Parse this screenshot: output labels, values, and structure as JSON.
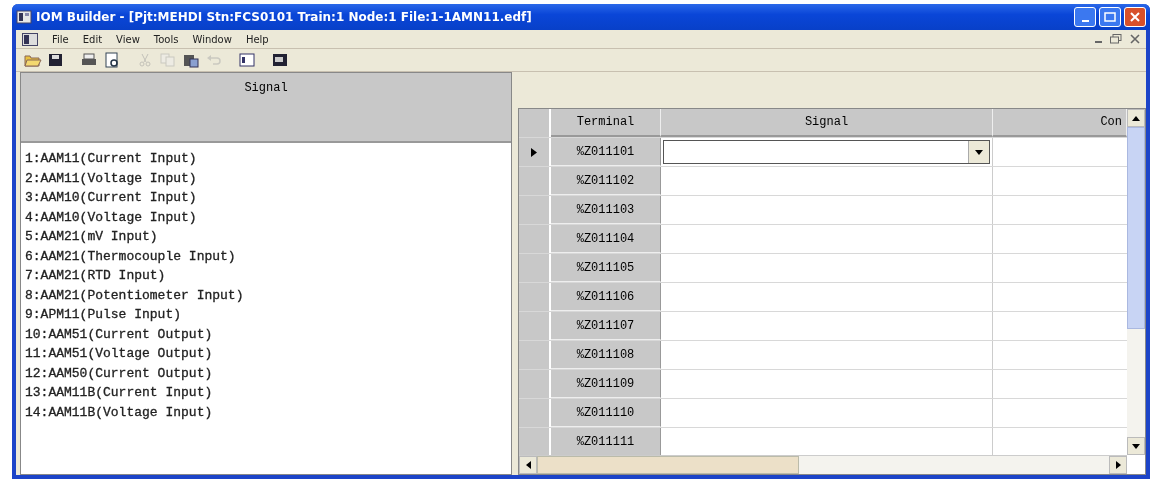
{
  "window": {
    "title": "IOM Builder - [Pjt:MEHDI Stn:FCS0101 Train:1 Node:1 File:1-1AMN11.edf]"
  },
  "menu": [
    "File",
    "Edit",
    "View",
    "Tools",
    "Window",
    "Help"
  ],
  "toolbar": [
    {
      "kind": "open",
      "disabled": false
    },
    {
      "kind": "save",
      "disabled": false
    },
    {
      "kind": "print",
      "disabled": false
    },
    {
      "kind": "preview",
      "disabled": false
    },
    {
      "kind": "cut",
      "disabled": true
    },
    {
      "kind": "copy",
      "disabled": true
    },
    {
      "kind": "paste",
      "disabled": false
    },
    {
      "kind": "undo",
      "disabled": true
    },
    {
      "kind": "panel-left",
      "disabled": false
    },
    {
      "kind": "panel-dark",
      "disabled": false
    }
  ],
  "signal_list": {
    "header": "Signal",
    "items": [
      "1:AAM11(Current Input)",
      "2:AAM11(Voltage Input)",
      "3:AAM10(Current Input)",
      "4:AAM10(Voltage Input)",
      "5:AAM21(mV Input)",
      "6:AAM21(Thermocouple Input)",
      "7:AAM21(RTD Input)",
      "8:AAM21(Potentiometer Input)",
      "9:APM11(Pulse Input)",
      "10:AAM51(Current Output)",
      "11:AAM51(Voltage Output)",
      "12:AAM50(Current Output)",
      "13:AAM11B(Current Input)",
      "14:AAM11B(Voltage Input)"
    ]
  },
  "grid": {
    "columns": [
      "Terminal",
      "Signal",
      "Con"
    ],
    "rows": [
      {
        "terminal": "%Z011101",
        "selected": true
      },
      {
        "terminal": "%Z011102",
        "selected": false
      },
      {
        "terminal": "%Z011103",
        "selected": false
      },
      {
        "terminal": "%Z011104",
        "selected": false
      },
      {
        "terminal": "%Z011105",
        "selected": false
      },
      {
        "terminal": "%Z011106",
        "selected": false
      },
      {
        "terminal": "%Z011107",
        "selected": false
      },
      {
        "terminal": "%Z011108",
        "selected": false
      },
      {
        "terminal": "%Z011109",
        "selected": false
      },
      {
        "terminal": "%Z011110",
        "selected": false
      },
      {
        "terminal": "%Z011111",
        "selected": false
      }
    ]
  }
}
